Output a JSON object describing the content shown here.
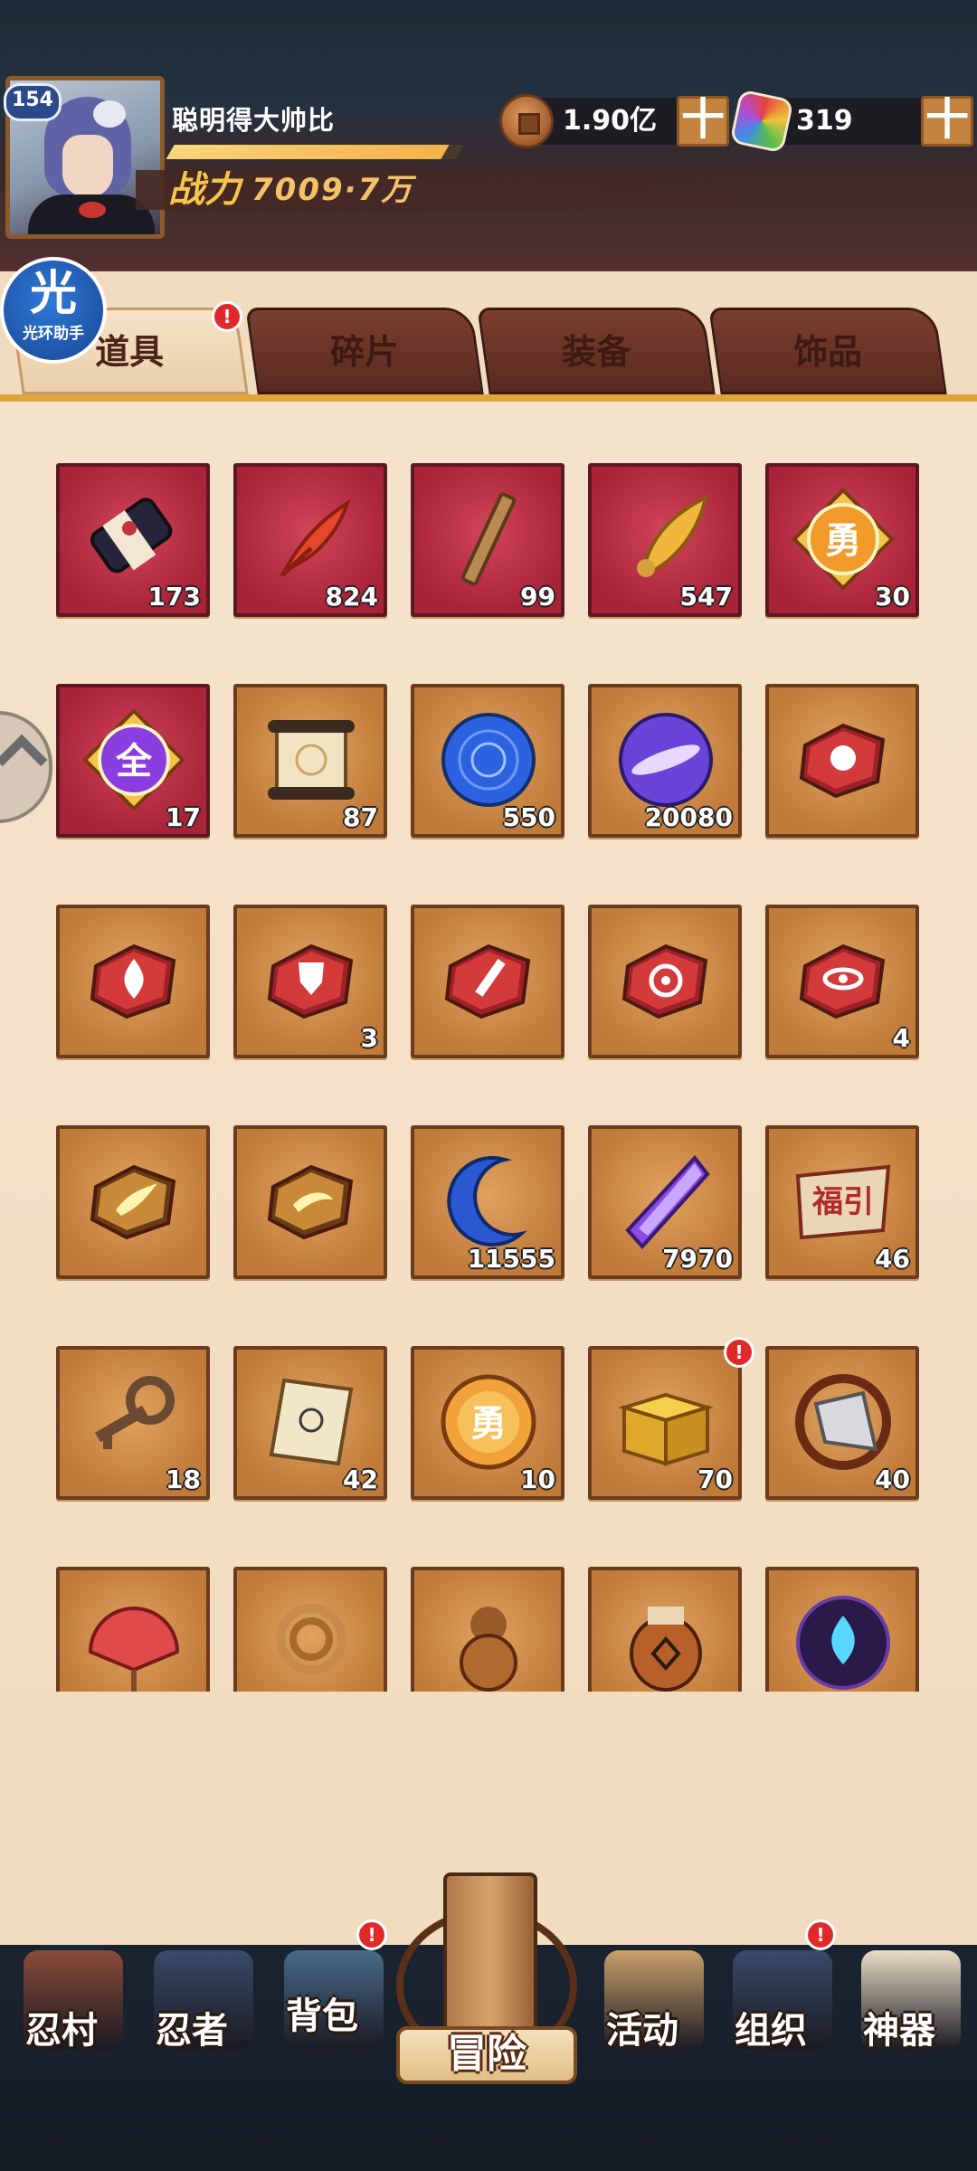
{
  "player": {
    "level": "154",
    "name": "聪明得大帅比",
    "exp_fraction": 0.95,
    "power_label": "战力",
    "power_value": "7009·7万"
  },
  "resources": {
    "coins": "1.90亿",
    "gems": "319",
    "add_symbol": "十"
  },
  "helper": {
    "icon_char": "光",
    "label": "光环助手"
  },
  "tabs": [
    {
      "label": "道具",
      "active": true,
      "alert": "!"
    },
    {
      "label": "碎片",
      "active": false
    },
    {
      "label": "装备",
      "active": false
    },
    {
      "label": "饰品",
      "active": false
    }
  ],
  "items": [
    {
      "icon": "scroll-bundle-icon",
      "frame": "red",
      "count": "173"
    },
    {
      "icon": "red-feather-icon",
      "frame": "red",
      "count": "824"
    },
    {
      "icon": "wooden-stick-icon",
      "frame": "red",
      "count": "99"
    },
    {
      "icon": "golden-feather-icon",
      "frame": "red",
      "count": "547"
    },
    {
      "icon": "courage-medal-icon",
      "frame": "red",
      "count": "30",
      "glyph_text": "勇"
    },
    {
      "icon": "all-medal-icon",
      "frame": "red",
      "count": "17",
      "glyph_text": "全"
    },
    {
      "icon": "map-scroll-icon",
      "frame": "brown",
      "count": "87"
    },
    {
      "icon": "blue-orb-icon",
      "frame": "brown",
      "count": "550"
    },
    {
      "icon": "purple-orb-icon",
      "frame": "brown",
      "count": "20080"
    },
    {
      "icon": "fist-rune-stone-icon",
      "frame": "brown",
      "count": ""
    },
    {
      "icon": "fire-rune-stone-icon",
      "frame": "brown",
      "count": ""
    },
    {
      "icon": "shield-rune-stone-icon",
      "frame": "brown",
      "count": "3"
    },
    {
      "icon": "sword-rune-stone-icon",
      "frame": "brown",
      "count": ""
    },
    {
      "icon": "target-rune-stone-icon",
      "frame": "brown",
      "count": ""
    },
    {
      "icon": "eye-rune-stone-icon",
      "frame": "brown",
      "count": "4"
    },
    {
      "icon": "flame-gold-stone-icon",
      "frame": "brown",
      "count": ""
    },
    {
      "icon": "wind-gold-stone-icon",
      "frame": "brown",
      "count": ""
    },
    {
      "icon": "crescent-moon-icon",
      "frame": "brown",
      "count": "11555"
    },
    {
      "icon": "purple-crystal-icon",
      "frame": "brown",
      "count": "7970"
    },
    {
      "icon": "fortune-ticket-icon",
      "frame": "brown",
      "count": "46",
      "glyph_text": "福引"
    },
    {
      "icon": "key-icon",
      "frame": "brown",
      "count": "18"
    },
    {
      "icon": "seal-paper-icon",
      "frame": "brown",
      "count": "42"
    },
    {
      "icon": "courage-coin-icon",
      "frame": "brown",
      "count": "10",
      "glyph_text": "勇"
    },
    {
      "icon": "gold-box-icon",
      "frame": "brown",
      "count": "70",
      "alert": "!"
    },
    {
      "icon": "silver-blade-icon",
      "frame": "brown",
      "count": "40"
    },
    {
      "icon": "red-fan-icon",
      "frame": "brown",
      "count": ""
    },
    {
      "icon": "rope-icon",
      "frame": "brown",
      "count": ""
    },
    {
      "icon": "gourd-icon",
      "frame": "brown",
      "count": ""
    },
    {
      "icon": "sealed-jar-icon",
      "frame": "brown",
      "count": ""
    },
    {
      "icon": "blue-flame-orb-icon",
      "frame": "brown",
      "count": ""
    }
  ],
  "nav": [
    {
      "label": "忍村",
      "icon": "village-gate-icon"
    },
    {
      "label": "忍者",
      "icon": "ninja-head-icon"
    },
    {
      "label": "背包",
      "icon": "backpack-icon",
      "alert": "!"
    },
    {
      "label": "冒险",
      "icon": "adventure-scroll-icon"
    },
    {
      "label": "活动",
      "icon": "drum-icon"
    },
    {
      "label": "组织",
      "icon": "organization-icon",
      "alert": "!"
    },
    {
      "label": "神器",
      "icon": "artifact-scroll-icon"
    }
  ],
  "colors": {
    "tab_line": "#e0a53a",
    "alert_red": "#e02a2a",
    "power_gold": "#f6c54b",
    "tile_red": "#a82238",
    "tile_brown": "#c07a3a"
  }
}
